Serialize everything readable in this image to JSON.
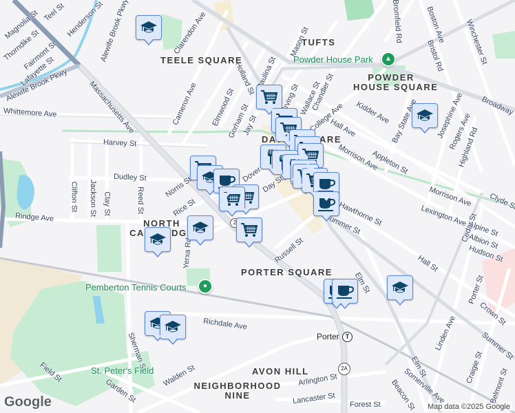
{
  "colors": {
    "background": "#f4f3f5",
    "park": "#c7ecd3",
    "water": "#8fd4ec",
    "road": "#ffffff",
    "road_edge": "#d3d8df",
    "parkway": "#8a9bb3",
    "marker_fill": "#dde8fb",
    "marker_border": "#5b86d4",
    "icon": "#0d4467",
    "poi_green": "#1e8c58"
  },
  "places": {
    "teele": "TEELE SQUARE",
    "tufts": "TUFTS",
    "powder_1": "POWDER",
    "powder_2": "HOUSE SQUARE",
    "davis": "DAVIS SQUARE",
    "northcam_1": "NORTH",
    "northcam_2": "CAMBRIDGE",
    "porter_sq": "PORTER SQUARE",
    "avon": "AVON HILL",
    "nn_1": "NEIGHBORHOOD",
    "nn_2": "NINE"
  },
  "pois": {
    "powder_park": "Powder House Park",
    "pemberton": "Pemberton Tennis Courts",
    "st_peters": "St. Peter's Field"
  },
  "transit": {
    "porter": "Porter",
    "t_symbol": "T",
    "route": "2A",
    "route_small": "2"
  },
  "streets": [
    "Teel St",
    "Henderson St",
    "Magnolia St",
    "Thorndike St",
    "Fairmont St",
    "Lafayette St",
    "Alewife Brook Pkwy",
    "Alewife Brook Pkwy",
    "Massachusetts Ave",
    "Whittemore Ave",
    "Harvey St",
    "Dudley St",
    "Clifton St",
    "Jackson St",
    "Clay St",
    "Reed St",
    "Rice St",
    "Norris St",
    "Rindge Ave",
    "Cameron Ave",
    "Clarendon Ave",
    "Elmwood St",
    "Gorham St",
    "Jay St",
    "Holland St",
    "Paulina St",
    "Mason St",
    "Irving St",
    "Wallace St",
    "Chandler St",
    "College Ave",
    "Kidder Ave",
    "Hall Ave",
    "Morrison Ave",
    "Appleton St",
    "Bay State Ave",
    "Josephine Ave",
    "Rogers Ave",
    "Highland Rd",
    "Bromfield Rd",
    "Boston Ave",
    "Bristol Rd",
    "Winchester St",
    "Broadway",
    "Morrison Ave",
    "Clyde St",
    "Lexington Ave",
    "Alpine St",
    "Albion St",
    "Hudson St",
    "Cedar St",
    "Hawthorne St",
    "Summer St",
    "Day St",
    "Dover St",
    "Russell St",
    "Elm St",
    "Hall St",
    "Porter St",
    "Crown St",
    "Linden Ave",
    "Summer St",
    "Elm St",
    "Craigie St",
    "Belmont St",
    "Somerville Ave",
    "Beacon St",
    "Arlington St",
    "Lancaster St",
    "Forest St",
    "Richdale Ave",
    "Sherman St",
    "Walden St",
    "Field St",
    "Garden St",
    "Yerxa Rd"
  ],
  "markers": [
    "school",
    "cart",
    "cart",
    "cart",
    "cart",
    "school",
    "coffee",
    "cart",
    "cart",
    "school",
    "school",
    "cart",
    "cart",
    "cart",
    "cart",
    "restaurant",
    "restaurant",
    "restaurant",
    "restaurant",
    "cart",
    "cart",
    "coffee",
    "coffee",
    "coffee",
    "coffee",
    "school",
    "school",
    "school",
    "school"
  ],
  "attribution": "Map data ©2025 Google",
  "logo": "Google"
}
